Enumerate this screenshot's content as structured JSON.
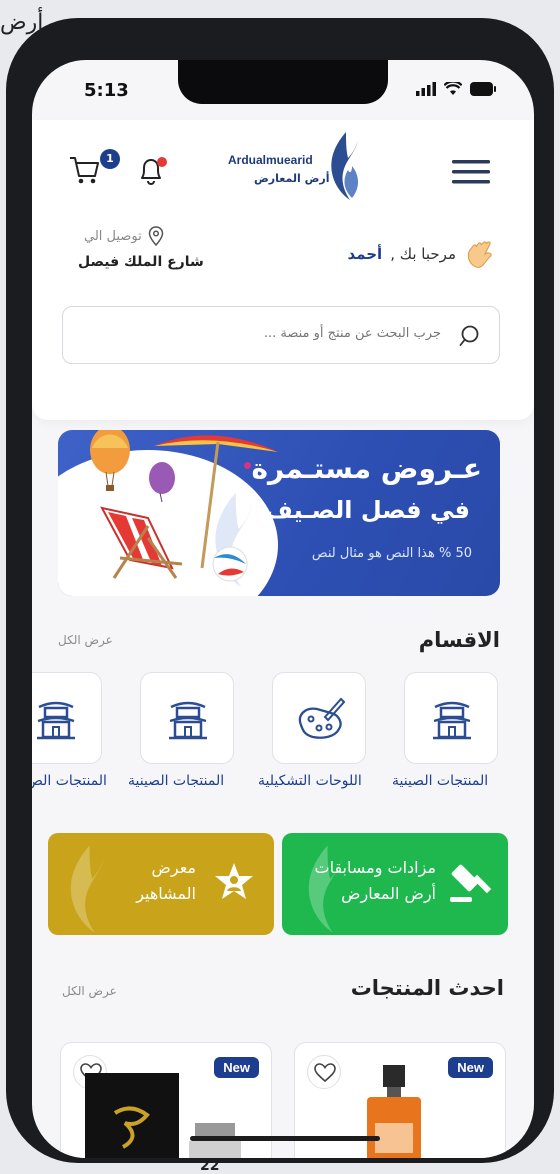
{
  "background": {
    "top_text": "أرض",
    "bottom_text": "22"
  },
  "status_bar": {
    "time": "5:13"
  },
  "header": {
    "cart_count": "1",
    "logo_en": "Ardualmuearid",
    "logo_ar": "أرض المعارض",
    "greeting_prefix": "مرحبا بك ,",
    "user_name": "أحمد",
    "deliver_label": "توصيل الي",
    "deliver_address": "شارع الملك فيصل",
    "search_placeholder": "جرب البحث عن منتج أو منصة ..."
  },
  "banner": {
    "title_line1": "عـروض مستـمرة",
    "title_line2": "في فصل الصـيف",
    "subtitle": "50 % هذا النص هو مثال لنص"
  },
  "categories": {
    "title": "الاقسام",
    "see_all": "عرض الكل",
    "items": [
      {
        "label": "المنتجات الصينية",
        "icon": "pagoda-icon"
      },
      {
        "label": "اللوحات التشكيلية",
        "icon": "palette-icon"
      },
      {
        "label": "المنتجات الصينية",
        "icon": "pagoda-icon"
      },
      {
        "label": "المنتجات الص",
        "icon": "pagoda-icon"
      }
    ]
  },
  "promos": {
    "auctions": {
      "line1": "مزادات ومسابقات",
      "line2": "أرض المعارض",
      "color": "#1fb84f"
    },
    "celebrities": {
      "line1": "معرض",
      "line2": "المشاهير",
      "color": "#c9a41a"
    }
  },
  "latest": {
    "title": "احدث المنتجات",
    "see_all": "عرض الكل",
    "products": [
      {
        "badge": "New"
      },
      {
        "badge": "New"
      }
    ]
  },
  "colors": {
    "primary": "#1d3d8f",
    "accent_red": "#e53935"
  }
}
